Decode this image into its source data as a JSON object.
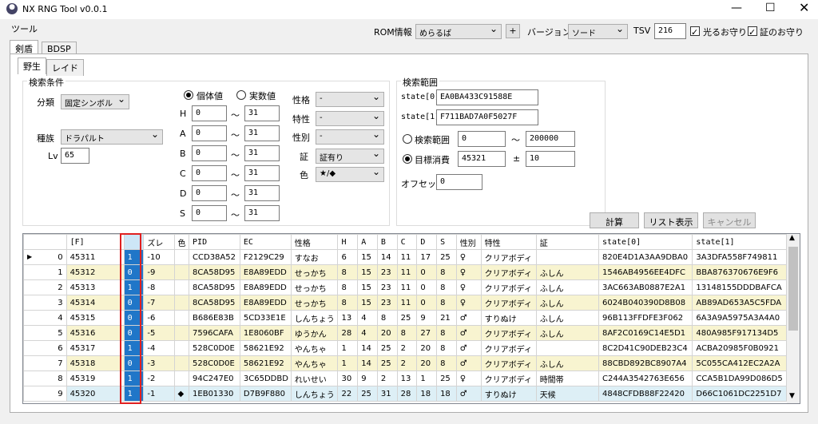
{
  "window": {
    "title": "NX RNG Tool v0.0.1",
    "menu_tools": "ツール"
  },
  "header": {
    "rom_label": "ROM情報",
    "rom_value": "めらるば",
    "plus": "+",
    "version_label": "バージョン",
    "version_value": "ソード",
    "tsv_label": "TSV",
    "tsv_value": "216",
    "shiny_charm": "光るお守り",
    "mark_charm": "証のお守り"
  },
  "tabs": {
    "outer": [
      "剣盾",
      "BDSP"
    ],
    "inner": [
      "野生",
      "レイド"
    ]
  },
  "search": {
    "title": "検索条件",
    "class_label": "分類",
    "class_value": "固定シンボル",
    "species_label": "種族",
    "species_value": "ドラパルト",
    "lv_label": "Lv",
    "lv_value": "65",
    "iv_radio": "個体値",
    "actual_radio": "実数値",
    "tilde": "〜",
    "stats": [
      {
        "l": "H",
        "min": "0",
        "max": "31"
      },
      {
        "l": "A",
        "min": "0",
        "max": "31"
      },
      {
        "l": "B",
        "min": "0",
        "max": "31"
      },
      {
        "l": "C",
        "min": "0",
        "max": "31"
      },
      {
        "l": "D",
        "min": "0",
        "max": "31"
      },
      {
        "l": "S",
        "min": "0",
        "max": "31"
      }
    ],
    "filters": [
      {
        "l": "性格",
        "v": "-"
      },
      {
        "l": "特性",
        "v": "-"
      },
      {
        "l": "性別",
        "v": "-"
      },
      {
        "l": "証",
        "v": "証有り"
      },
      {
        "l": "色",
        "v": "★/◆"
      }
    ]
  },
  "range": {
    "title": "検索範囲",
    "s0_label": "state[0]",
    "s0": "EA0BA433C91588E",
    "s1_label": "state[1]",
    "s1": "F711BAD7A0F5027F",
    "range_radio": "検索範囲",
    "range_min": "0",
    "range_tilde": "〜",
    "range_max": "200000",
    "target_radio": "目標消費",
    "target": "45321",
    "pm": "±",
    "target_pm": "10",
    "offset_label": "オフセット",
    "offset": "0"
  },
  "actions": {
    "calc": "計算",
    "list": "リスト表示",
    "cancel": "キャンセル"
  },
  "grid": {
    "headers": [
      "",
      "[F]",
      "",
      "ズレ",
      "色",
      "PID",
      "EC",
      "性格",
      "H",
      "A",
      "B",
      "C",
      "D",
      "S",
      "性別",
      "特性",
      "証",
      "state[0]",
      "state[1]"
    ],
    "rows": [
      [
        "0",
        "45311",
        "1",
        "-10",
        "",
        "CCD38A52",
        "F2129C29",
        "すなお",
        "6",
        "15",
        "14",
        "11",
        "17",
        "25",
        "♀",
        "クリアボディ",
        "",
        "820E4D1A3AA9DBA0",
        "3A3DFA558F749811"
      ],
      [
        "1",
        "45312",
        "0",
        "-9",
        "",
        "8CA58D95",
        "E8A89EDD",
        "せっかち",
        "8",
        "15",
        "23",
        "11",
        "0",
        "8",
        "♀",
        "クリアボディ",
        "ふしん",
        "1546AB4956EE4DFC",
        "BBA876370676E9F6"
      ],
      [
        "2",
        "45313",
        "1",
        "-8",
        "",
        "8CA58D95",
        "E8A89EDD",
        "せっかち",
        "8",
        "15",
        "23",
        "11",
        "0",
        "8",
        "♀",
        "クリアボディ",
        "ふしん",
        "3AC663AB0887E2A1",
        "13148155DDDBAFCA"
      ],
      [
        "3",
        "45314",
        "0",
        "-7",
        "",
        "8CA58D95",
        "E8A89EDD",
        "せっかち",
        "8",
        "15",
        "23",
        "11",
        "0",
        "8",
        "♀",
        "クリアボディ",
        "ふしん",
        "6024B040390D8B08",
        "AB89AD653A5C5FDA"
      ],
      [
        "4",
        "45315",
        "0",
        "-6",
        "",
        "B686E83B",
        "5CD33E1E",
        "しんちょう",
        "13",
        "4",
        "8",
        "25",
        "9",
        "21",
        "♂",
        "すりぬけ",
        "ふしん",
        "96B113FFDFE3F062",
        "6A3A9A5975A3A4A0"
      ],
      [
        "5",
        "45316",
        "0",
        "-5",
        "",
        "7596CAFA",
        "1E8060BF",
        "ゆうかん",
        "28",
        "4",
        "20",
        "8",
        "27",
        "8",
        "♂",
        "クリアボディ",
        "ふしん",
        "8AF2C0169C14E5D1",
        "480A985F917134D5"
      ],
      [
        "6",
        "45317",
        "1",
        "-4",
        "",
        "528C0D0E",
        "58621E92",
        "やんちゃ",
        "1",
        "14",
        "25",
        "2",
        "20",
        "8",
        "♂",
        "クリアボディ",
        "",
        "8C2D41C90DEB23C4",
        "ACBA20985F0B0921"
      ],
      [
        "7",
        "45318",
        "0",
        "-3",
        "",
        "528C0D0E",
        "58621E92",
        "やんちゃ",
        "1",
        "14",
        "25",
        "2",
        "20",
        "8",
        "♂",
        "クリアボディ",
        "ふしん",
        "88CBD892BC8907A4",
        "5C055CA412EC2A2A"
      ],
      [
        "8",
        "45319",
        "1",
        "-2",
        "",
        "94C247E0",
        "3C65DDBD",
        "れいせい",
        "30",
        "9",
        "2",
        "13",
        "1",
        "25",
        "♀",
        "クリアボディ",
        "時間帯",
        "C244A3542763E656",
        "CCA5B1DA99D086D5"
      ],
      [
        "9",
        "45320",
        "1",
        "-1",
        "◆",
        "1EB01330",
        "D7B9F880",
        "しんちょう",
        "22",
        "25",
        "31",
        "28",
        "18",
        "18",
        "♂",
        "すりぬけ",
        "天候",
        "4848CFDB88F22420",
        "D66C1061DC2251D7"
      ]
    ]
  },
  "colors": {
    "yellow": "#f8f4d0",
    "blue": "#ddeff6",
    "cell_sel": "#2076c8",
    "red": "#e02020"
  },
  "icons": [
    "app-icon",
    "minimize-icon",
    "maximize-icon",
    "close-icon",
    "row-pointer-icon",
    "scroll-up-icon",
    "scroll-down-icon"
  ]
}
